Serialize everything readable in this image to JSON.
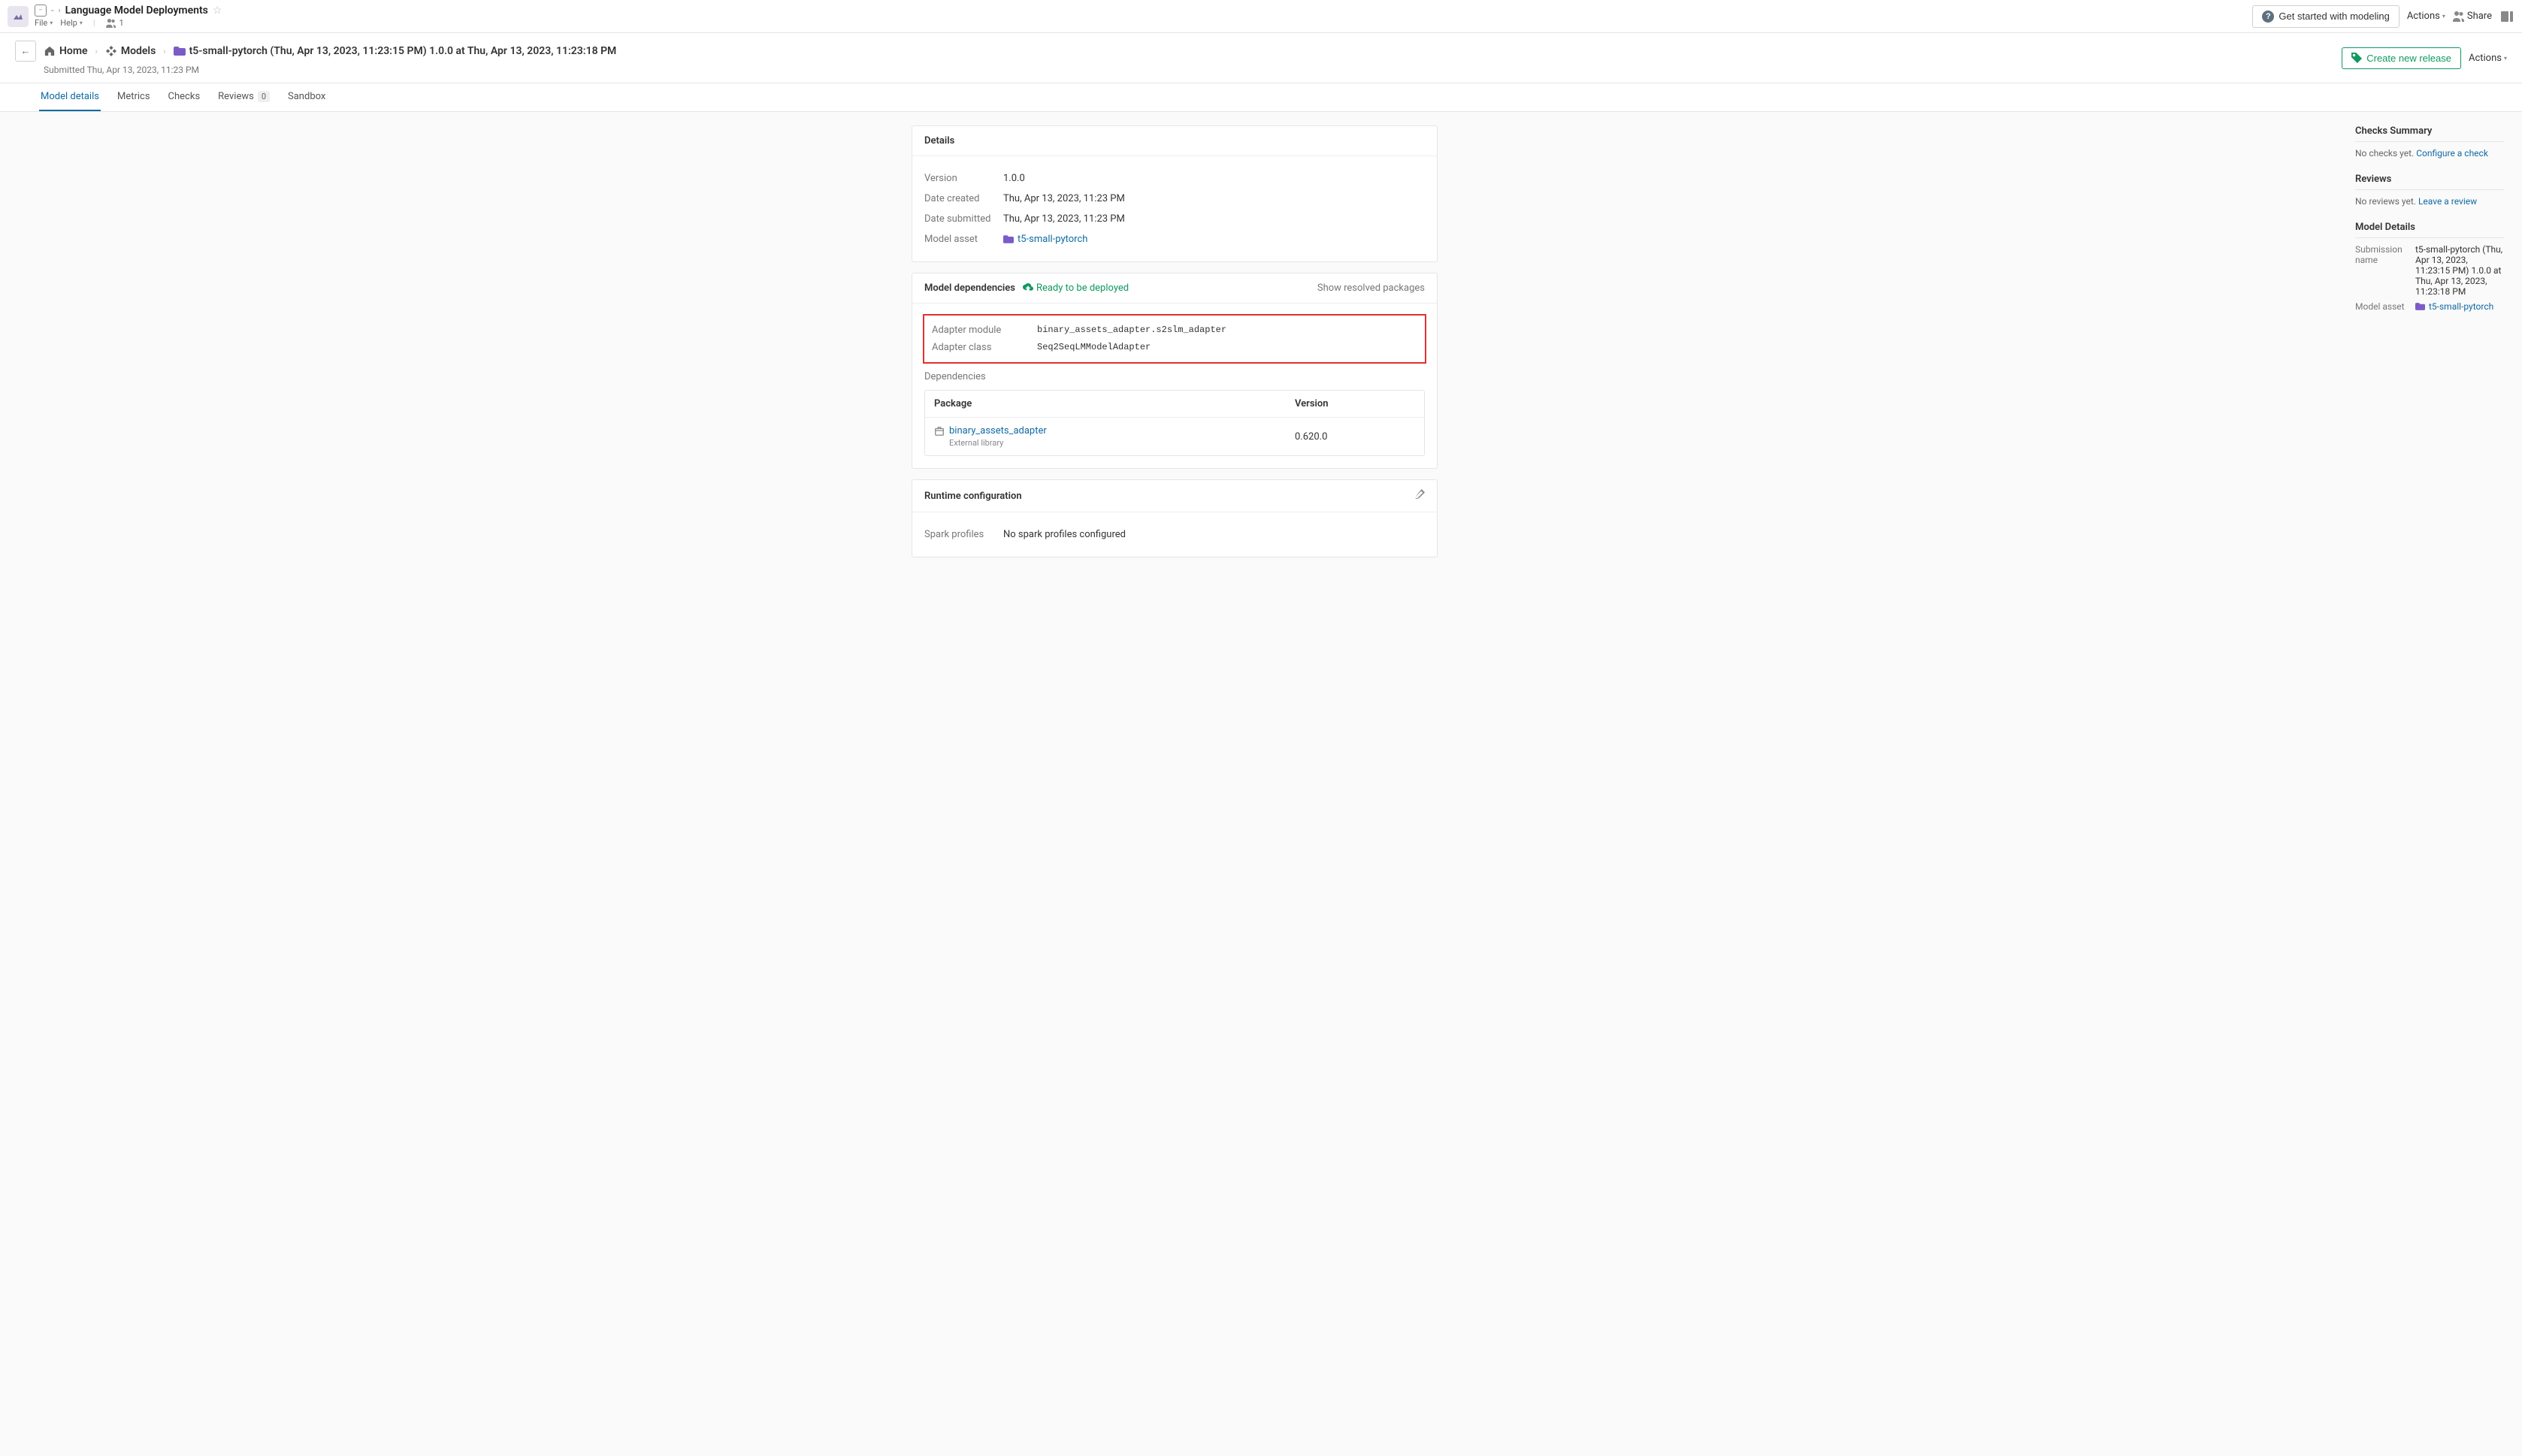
{
  "header": {
    "app_title": "Language Model Deployments",
    "file_menu": "File",
    "help_menu": "Help",
    "users_count": "1",
    "get_started": "Get started with modeling",
    "actions": "Actions",
    "share": "Share"
  },
  "breadcrumb": {
    "home": "Home",
    "models": "Models",
    "current": "t5-small-pytorch (Thu, Apr 13, 2023, 11:23:15 PM) 1.0.0 at Thu, Apr 13, 2023, 11:23:18 PM",
    "submitted": "Submitted Thu, Apr 13, 2023, 11:23 PM",
    "create_release": "Create new release",
    "actions": "Actions"
  },
  "tabs": {
    "model_details": "Model details",
    "metrics": "Metrics",
    "checks": "Checks",
    "reviews": "Reviews",
    "reviews_count": "0",
    "sandbox": "Sandbox"
  },
  "details_card": {
    "title": "Details",
    "version_label": "Version",
    "version_value": "1.0.0",
    "date_created_label": "Date created",
    "date_created_value": "Thu, Apr 13, 2023, 11:23 PM",
    "date_submitted_label": "Date submitted",
    "date_submitted_value": "Thu, Apr 13, 2023, 11:23 PM",
    "model_asset_label": "Model asset",
    "model_asset_value": "t5-small-pytorch"
  },
  "deps_card": {
    "title": "Model dependencies",
    "ready": "Ready to be deployed",
    "show_resolved": "Show resolved packages",
    "adapter_module_label": "Adapter module",
    "adapter_module_value": "binary_assets_adapter.s2slm_adapter",
    "adapter_class_label": "Adapter class",
    "adapter_class_value": "Seq2SeqLMModelAdapter",
    "deps_label": "Dependencies",
    "col_package": "Package",
    "col_version": "Version",
    "package_name": "binary_assets_adapter",
    "package_sub": "External library",
    "package_version": "0.620.0"
  },
  "runtime_card": {
    "title": "Runtime configuration",
    "spark_label": "Spark profiles",
    "spark_value": "No spark profiles configured"
  },
  "sidebar": {
    "checks_heading": "Checks Summary",
    "checks_text": "No checks yet. ",
    "checks_link": "Configure a check",
    "reviews_heading": "Reviews",
    "reviews_text": "No reviews yet. ",
    "reviews_link": "Leave a review",
    "details_heading": "Model Details",
    "submission_label": "Submission name",
    "submission_value": "t5-small-pytorch (Thu, Apr 13, 2023, 11:23:15 PM) 1.0.0 at Thu, Apr 13, 2023, 11:23:18 PM",
    "asset_label": "Model asset",
    "asset_value": "t5-small-pytorch"
  }
}
